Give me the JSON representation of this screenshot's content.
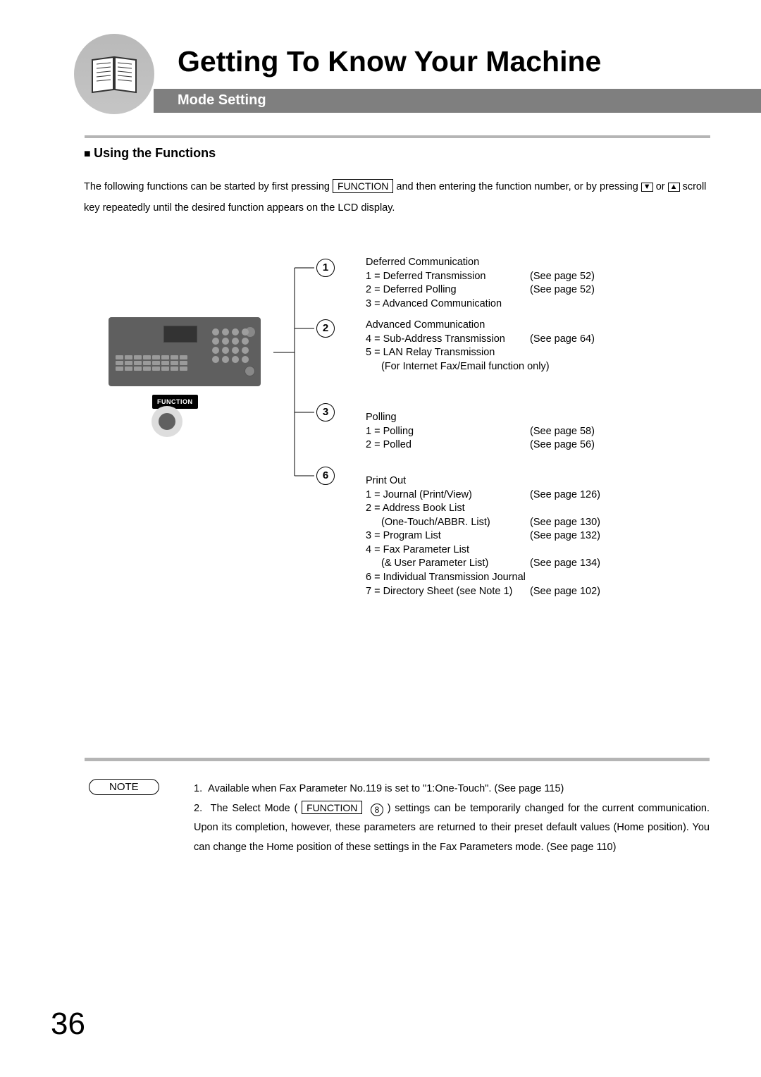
{
  "header": {
    "chapter_title": "Getting To Know Your Machine",
    "section_title": "Mode Setting",
    "subhead": "Using the Functions"
  },
  "intro": {
    "part1": "The following functions can be started by first pressing ",
    "function_key": "FUNCTION",
    "part2": " and then entering the function number, or by pressing ",
    "down_arrow": "▼",
    "or": " or ",
    "up_arrow": "▲",
    "part3": " scroll key repeatedly until the desired function appears on the LCD display."
  },
  "callout": {
    "label": "FUNCTION"
  },
  "tree": {
    "n1": "1",
    "n2": "2",
    "n3": "3",
    "n6": "6"
  },
  "func1": {
    "title": "Deferred Communication",
    "l1": "1 = Deferred Transmission",
    "l2": "2 = Deferred Polling",
    "l3": "3 = Advanced Communication",
    "r1": "(See page 52)",
    "r2": "(See page 52)"
  },
  "func2": {
    "title": "Advanced Communication",
    "l1": "4 = Sub-Address Transmission",
    "l2": "5 = LAN Relay Transmission",
    "l3": "(For Internet Fax/Email function only)",
    "r1": "(See page 64)"
  },
  "func3": {
    "title": "Polling",
    "l1": "1 = Polling",
    "l2": "2 = Polled",
    "r1": "(See page 58)",
    "r2": "(See page 56)"
  },
  "func6": {
    "title": "Print Out",
    "l1": "1 = Journal (Print/View)",
    "l2": "2 = Address Book List",
    "l2b": "(One-Touch/ABBR. List)",
    "l3": "3 = Program List",
    "l4": "4 = Fax Parameter List",
    "l4b": "(& User Parameter List)",
    "l5": "6 = Individual Transmission Journal",
    "l6": "7 = Directory Sheet (see Note 1)",
    "r1": "(See page 126)",
    "r2": "(See page 130)",
    "r3": "(See page 132)",
    "r4": "(See page 134)",
    "r5": "(See page 102)"
  },
  "note": {
    "label": "NOTE",
    "n1": "Available when Fax Parameter No.119 is set to \"1:One-Touch\". (See page 115)",
    "n2a": "The Select Mode ( ",
    "n2_key": "FUNCTION",
    "n2_eight": "8",
    "n2b": " ) settings can be temporarily changed for the current communication. Upon its completion, however, these parameters are returned to their preset default values (Home position). You can change the Home position of these settings in the Fax Parameters mode. (See page 110)"
  },
  "page_number": "36"
}
